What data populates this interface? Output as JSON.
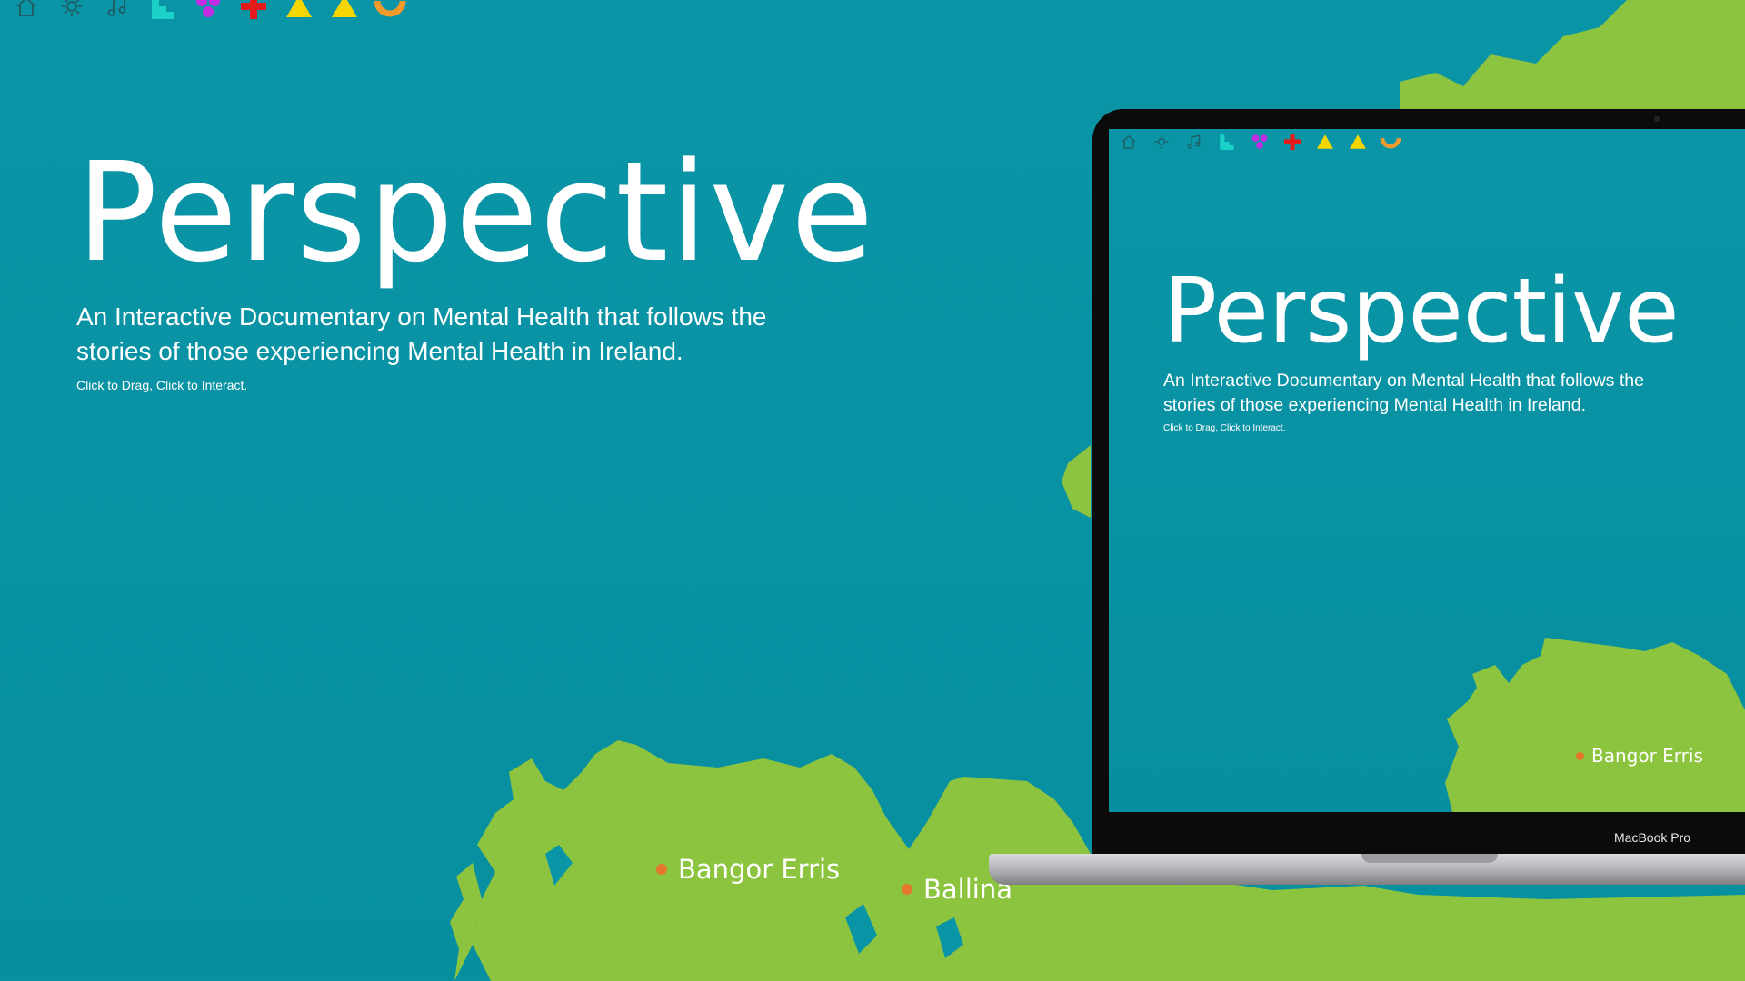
{
  "colors": {
    "background": "#0a95a7",
    "land": "#8dc43f",
    "marker": "#e5762d",
    "text": "#ffffff"
  },
  "toolbar": {
    "icons": [
      "home-icon",
      "sun-icon",
      "music-note-icon",
      "teal-steps-icon",
      "purple-cluster-icon",
      "red-cross-icon",
      "yellow-triangle-icon",
      "yellow-triangle-icon",
      "orange-arc-icon"
    ]
  },
  "hero": {
    "title": "Perspective",
    "subtitle": "An Interactive Documentary on Mental Health that follows the stories of those experiencing Mental Health in Ireland.",
    "hint": "Click to Drag, Click to Interact."
  },
  "map": {
    "places": [
      "Bangor Erris",
      "Ballina"
    ]
  },
  "laptop": {
    "brand": "MacBook Pro",
    "screen": {
      "title": "Perspective",
      "subtitle": "An Interactive Documentary on Mental Health that follows the stories of those experiencing Mental Health in Ireland.",
      "hint": "Click to Drag, Click to Interact.",
      "place": "Bangor Erris"
    }
  }
}
